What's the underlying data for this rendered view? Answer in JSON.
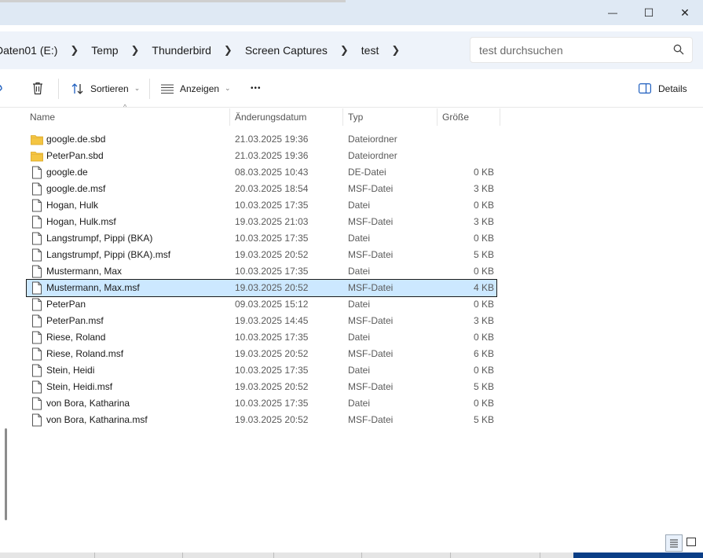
{
  "window": {
    "controls": {
      "minimize": "—",
      "maximize": "☐",
      "close": "✕"
    }
  },
  "breadcrumb": [
    "Daten01 (E:)",
    "Temp",
    "Thunderbird",
    "Screen Captures",
    "test"
  ],
  "search": {
    "placeholder": "test durchsuchen"
  },
  "toolbar": {
    "sort_label": "Sortieren",
    "view_label": "Anzeigen",
    "more_label": "•••",
    "details_label": "Details"
  },
  "columns": {
    "name": "Name",
    "date": "Änderungsdatum",
    "type": "Typ",
    "size": "Größe"
  },
  "files": [
    {
      "name": "google.de.sbd",
      "date": "21.03.2025 19:36",
      "type": "Dateiordner",
      "size": "",
      "icon": "folder-icon"
    },
    {
      "name": "PeterPan.sbd",
      "date": "21.03.2025 19:36",
      "type": "Dateiordner",
      "size": "",
      "icon": "folder-icon"
    },
    {
      "name": "google.de",
      "date": "08.03.2025 10:43",
      "type": "DE-Datei",
      "size": "0 KB",
      "icon": "file-icon"
    },
    {
      "name": "google.de.msf",
      "date": "20.03.2025 18:54",
      "type": "MSF-Datei",
      "size": "3 KB",
      "icon": "file-icon"
    },
    {
      "name": "Hogan, Hulk",
      "date": "10.03.2025 17:35",
      "type": "Datei",
      "size": "0 KB",
      "icon": "file-icon"
    },
    {
      "name": "Hogan, Hulk.msf",
      "date": "19.03.2025 21:03",
      "type": "MSF-Datei",
      "size": "3 KB",
      "icon": "file-icon"
    },
    {
      "name": "Langstrumpf, Pippi (BKA)",
      "date": "10.03.2025 17:35",
      "type": "Datei",
      "size": "0 KB",
      "icon": "file-icon"
    },
    {
      "name": "Langstrumpf, Pippi (BKA).msf",
      "date": "19.03.2025 20:52",
      "type": "MSF-Datei",
      "size": "5 KB",
      "icon": "file-icon"
    },
    {
      "name": "Mustermann, Max",
      "date": "10.03.2025 17:35",
      "type": "Datei",
      "size": "0 KB",
      "icon": "file-icon"
    },
    {
      "name": "Mustermann, Max.msf",
      "date": "19.03.2025 20:52",
      "type": "MSF-Datei",
      "size": "4 KB",
      "icon": "file-icon",
      "selected": true
    },
    {
      "name": "PeterPan",
      "date": "09.03.2025 15:12",
      "type": "Datei",
      "size": "0 KB",
      "icon": "file-icon"
    },
    {
      "name": "PeterPan.msf",
      "date": "19.03.2025 14:45",
      "type": "MSF-Datei",
      "size": "3 KB",
      "icon": "file-icon"
    },
    {
      "name": "Riese, Roland",
      "date": "10.03.2025 17:35",
      "type": "Datei",
      "size": "0 KB",
      "icon": "file-icon"
    },
    {
      "name": "Riese, Roland.msf",
      "date": "19.03.2025 20:52",
      "type": "MSF-Datei",
      "size": "6 KB",
      "icon": "file-icon"
    },
    {
      "name": "Stein, Heidi",
      "date": "10.03.2025 17:35",
      "type": "Datei",
      "size": "0 KB",
      "icon": "file-icon"
    },
    {
      "name": "Stein, Heidi.msf",
      "date": "19.03.2025 20:52",
      "type": "MSF-Datei",
      "size": "5 KB",
      "icon": "file-icon"
    },
    {
      "name": "von Bora, Katharina",
      "date": "10.03.2025 17:35",
      "type": "Datei",
      "size": "0 KB",
      "icon": "file-icon"
    },
    {
      "name": "von Bora, Katharina.msf",
      "date": "19.03.2025 20:52",
      "type": "MSF-Datei",
      "size": "5 KB",
      "icon": "file-icon"
    }
  ],
  "colors": {
    "selection": "#cce8ff",
    "folder": "#f4c542",
    "accent": "#0a3e86"
  }
}
